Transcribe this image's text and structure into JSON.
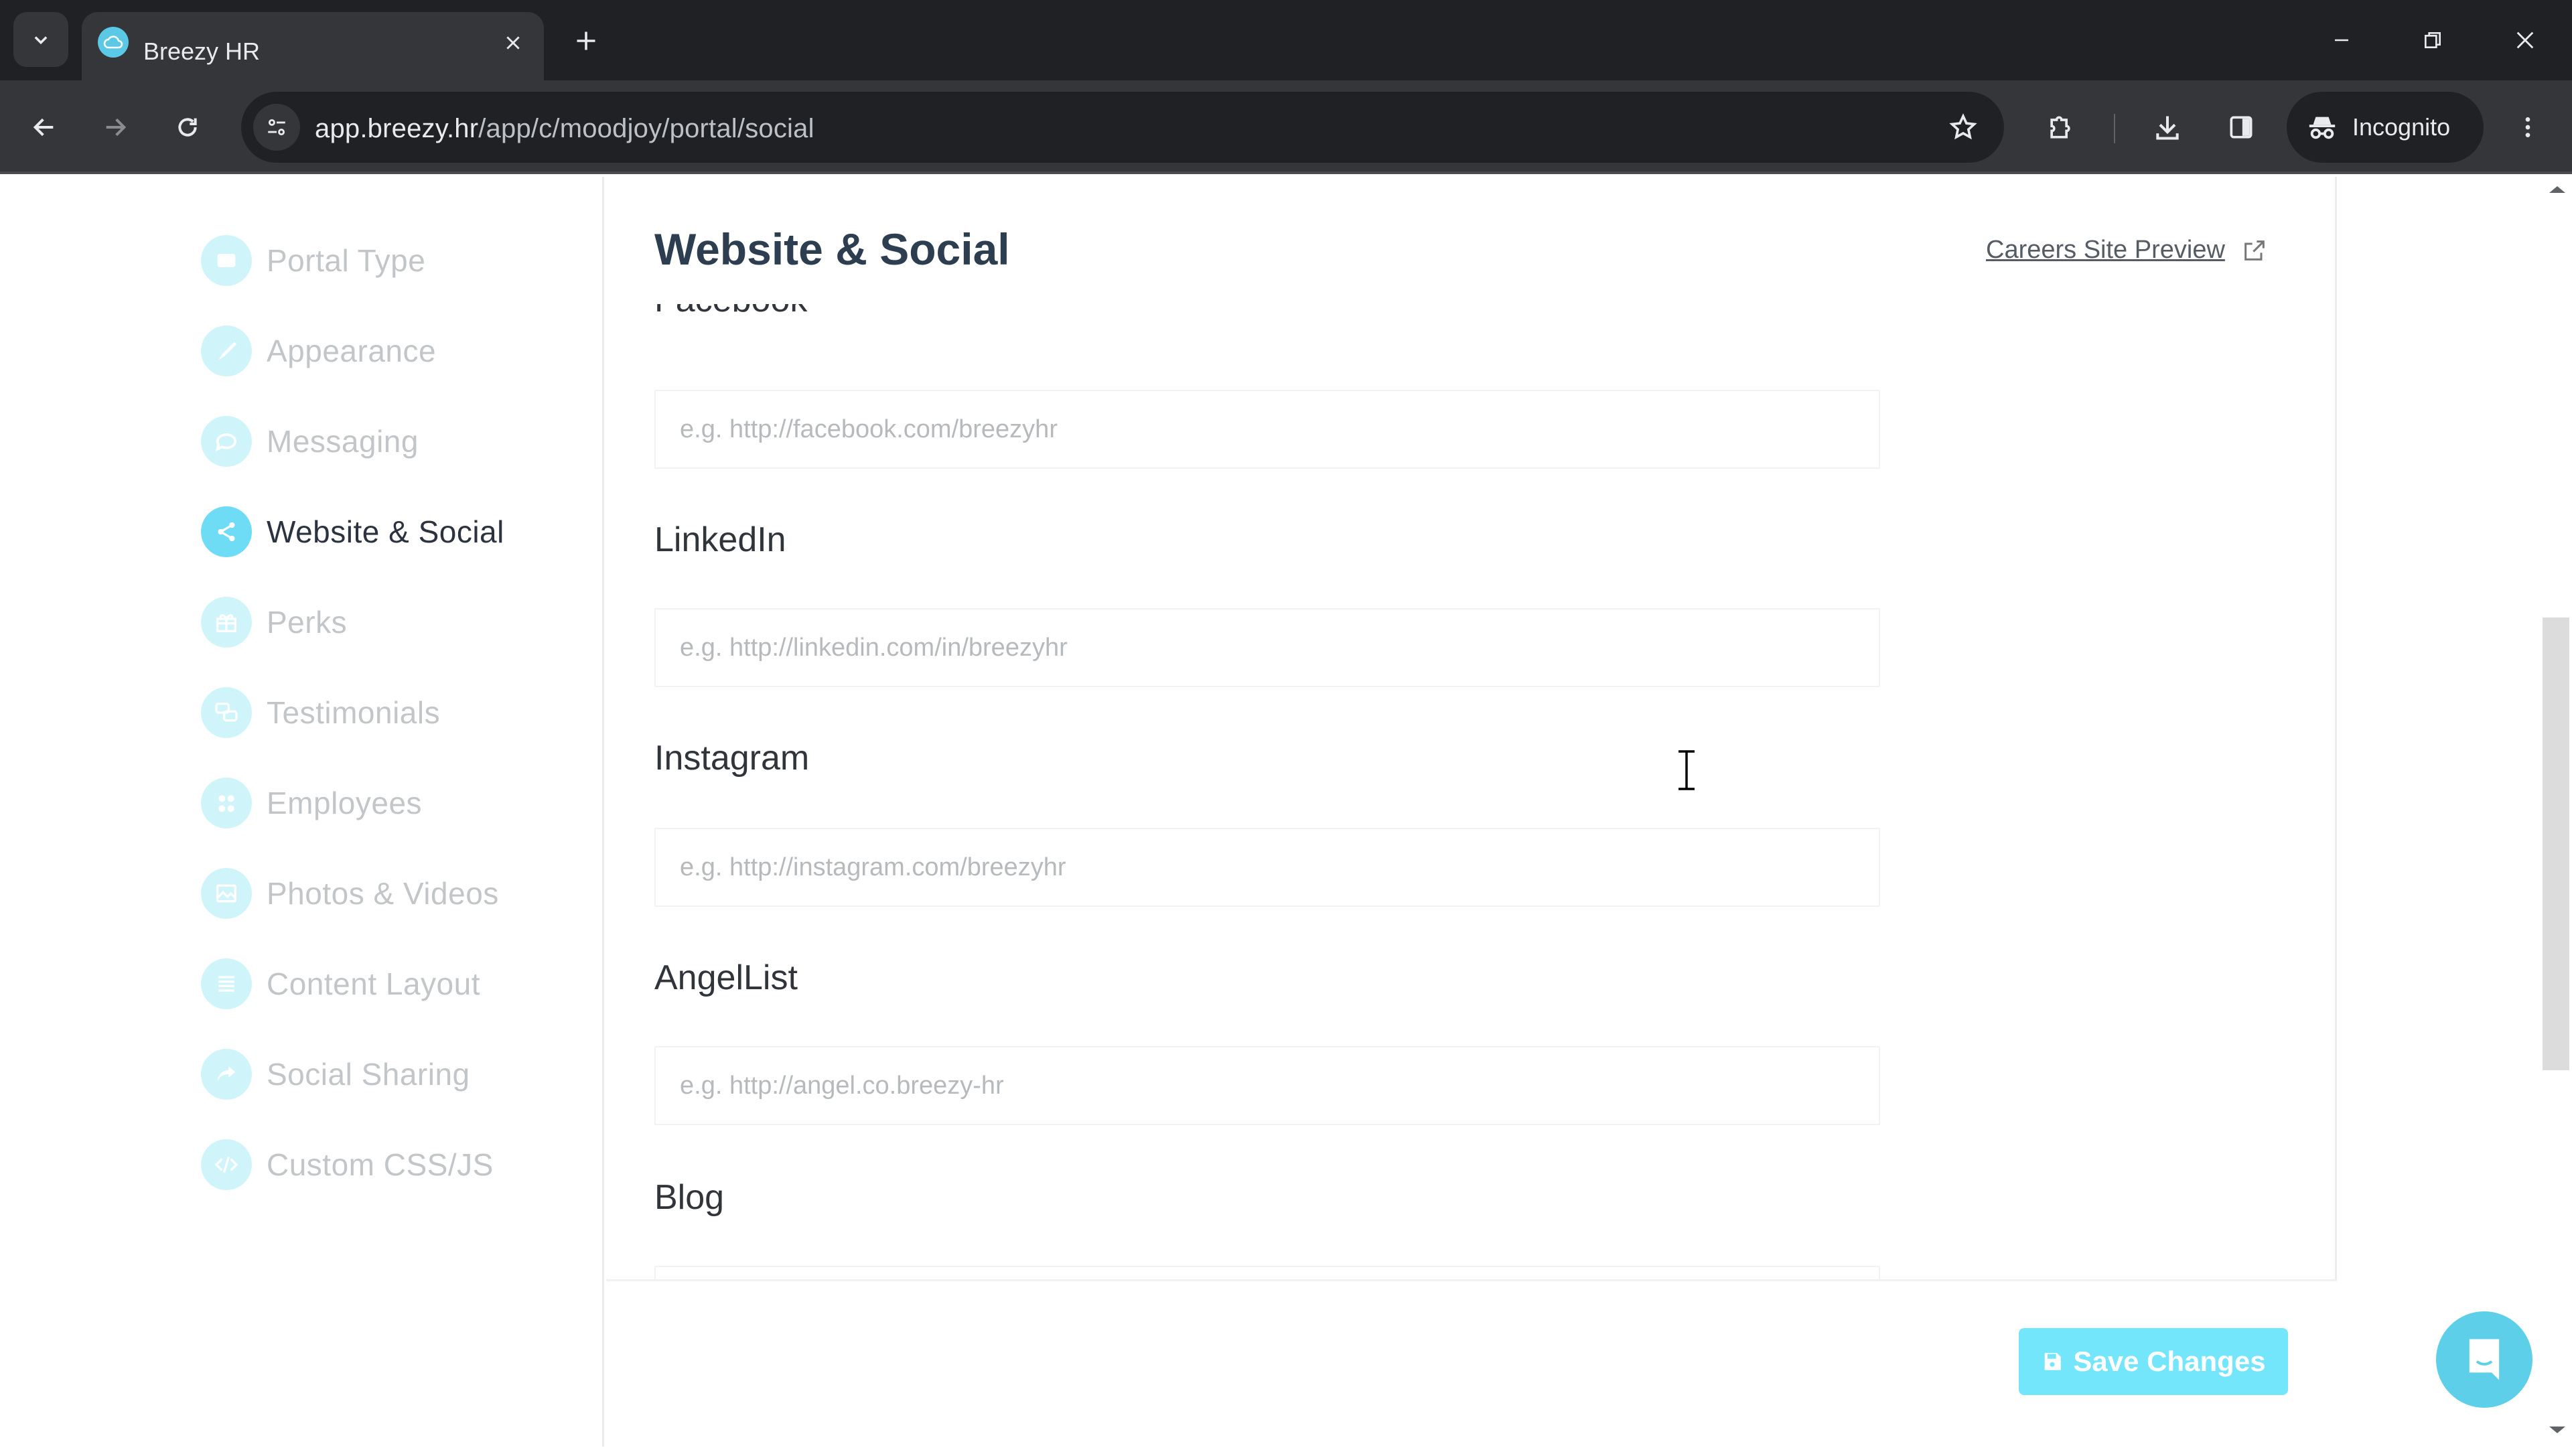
{
  "browser": {
    "tab_title": "Breezy HR",
    "url_host": "app.breezy.hr",
    "url_path": "/app/c/moodjoy/portal/social",
    "profile_label": "Incognito",
    "icons": {
      "tab_search": "chevron-down-icon",
      "favicon": "breezy-cloud-icon",
      "tab_close": "close-icon",
      "new_tab": "plus-icon",
      "minimize": "minimize-icon",
      "restore": "restore-icon",
      "close_window": "close-icon",
      "back": "arrow-left-icon",
      "forward": "arrow-right-icon",
      "reload": "reload-icon",
      "site_info": "tune-icon",
      "bookmark": "star-icon",
      "extensions": "puzzle-icon",
      "downloads": "download-icon",
      "side_panel": "side-panel-icon",
      "incognito": "incognito-icon",
      "menu": "more-vertical-icon"
    }
  },
  "sidebar": {
    "active_color": "#6fdcf5",
    "inactive_color": "#cff5fb",
    "items": [
      {
        "label": "Portal Type",
        "icon": "portal-type-icon",
        "active": false
      },
      {
        "label": "Appearance",
        "icon": "paintbrush-icon",
        "active": false
      },
      {
        "label": "Messaging",
        "icon": "chat-bubble-icon",
        "active": false
      },
      {
        "label": "Website & Social",
        "icon": "share-icon",
        "active": true
      },
      {
        "label": "Perks",
        "icon": "gift-icon",
        "active": false
      },
      {
        "label": "Testimonials",
        "icon": "testimonials-icon",
        "active": false
      },
      {
        "label": "Employees",
        "icon": "employees-icon",
        "active": false
      },
      {
        "label": "Photos & Videos",
        "icon": "photo-icon",
        "active": false
      },
      {
        "label": "Content Layout",
        "icon": "layout-lines-icon",
        "active": false
      },
      {
        "label": "Social Sharing",
        "icon": "share-arrow-icon",
        "active": false
      },
      {
        "label": "Custom CSS/JS",
        "icon": "code-icon",
        "active": false
      }
    ]
  },
  "main": {
    "title": "Website & Social",
    "preview_link": "Careers Site Preview",
    "fields": [
      {
        "label": "Facebook",
        "placeholder": "e.g. http://facebook.com/breezyhr",
        "value": ""
      },
      {
        "label": "LinkedIn",
        "placeholder": "e.g. http://linkedin.com/in/breezyhr",
        "value": ""
      },
      {
        "label": "Instagram",
        "placeholder": "e.g. http://instagram.com/breezyhr",
        "value": ""
      },
      {
        "label": "AngelList",
        "placeholder": "e.g. http://angel.co.breezy-hr",
        "value": ""
      },
      {
        "label": "Blog",
        "placeholder": "",
        "value": ""
      }
    ],
    "save_label": "Save Changes",
    "save_color": "#74e6fb"
  },
  "chat_widget": {
    "icon": "chat-smile-icon",
    "color": "#5ecfe9"
  }
}
